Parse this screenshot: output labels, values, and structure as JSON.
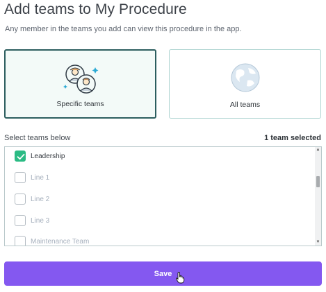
{
  "header": {
    "title": "Add teams to My Procedure",
    "subtitle": "Any member in the teams you add can view this procedure in the app."
  },
  "options": [
    {
      "label": "Specific teams",
      "icon": "team-people-icon",
      "selected": true
    },
    {
      "label": "All teams",
      "icon": "globe-icon",
      "selected": false
    }
  ],
  "selection": {
    "label": "Select teams below",
    "count_text": "1 team selected"
  },
  "teams": [
    {
      "label": "Leadership",
      "checked": true
    },
    {
      "label": "Line 1",
      "checked": false
    },
    {
      "label": "Line 2",
      "checked": false
    },
    {
      "label": "Line 3",
      "checked": false
    },
    {
      "label": "Maintenance Team",
      "checked": false
    }
  ],
  "actions": {
    "save_label": "Save"
  },
  "colors": {
    "accent": "#8458f0",
    "checked": "#2bbb84",
    "selected_border": "#2c5e5f"
  }
}
